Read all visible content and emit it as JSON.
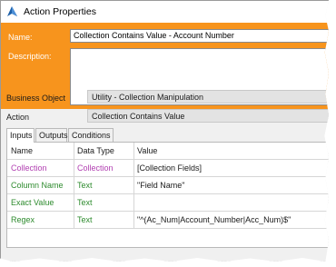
{
  "window": {
    "title": "Action Properties",
    "icon": "blueprism-logo-icon"
  },
  "header": {
    "name_label": "Name:",
    "name_value": "Collection Contains Value - Account Number",
    "description_label": "Description:",
    "description_value": "",
    "accent_color": "#f7941d"
  },
  "business_object": {
    "label": "Business Object",
    "value": "Utility - Collection Manipulation"
  },
  "action": {
    "label": "Action",
    "value": "Collection Contains Value"
  },
  "tabs": [
    {
      "label": "Inputs",
      "active": true
    },
    {
      "label": "Outputs",
      "active": false
    },
    {
      "label": "Conditions",
      "active": false
    }
  ],
  "grid": {
    "columns": [
      "Name",
      "Data Type",
      "Value"
    ],
    "rows": [
      {
        "name": "Collection",
        "type": "Collection",
        "value": "[Collection Fields]",
        "color": "#b13fb1"
      },
      {
        "name": "Column Name",
        "type": "Text",
        "value": "\"Field Name\"",
        "color": "#2e8b2e"
      },
      {
        "name": "Exact Value",
        "type": "Text",
        "value": "",
        "color": "#2e8b2e"
      },
      {
        "name": "Regex",
        "type": "Text",
        "value": "\"^(Ac_Num|Account_Number|Acc_Num)$\"",
        "color": "#2e8b2e"
      }
    ]
  }
}
